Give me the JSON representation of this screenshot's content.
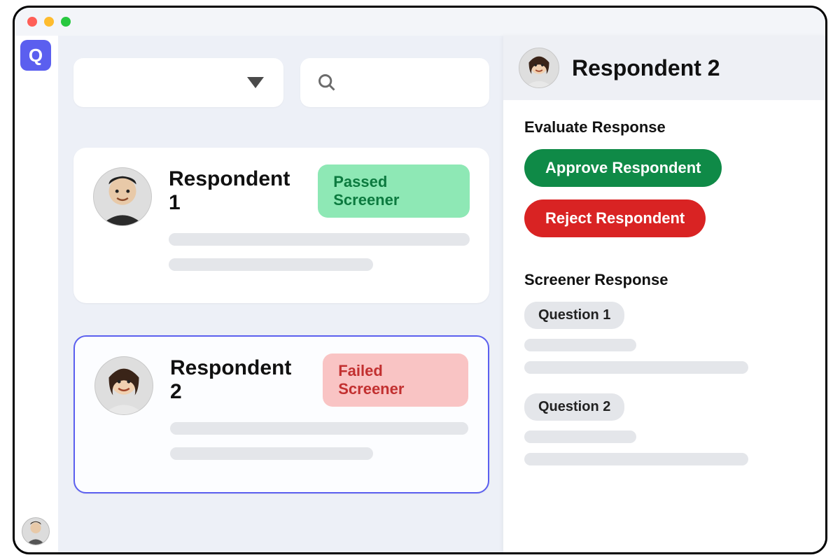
{
  "app": {
    "logo_letter": "Q"
  },
  "toolbar": {
    "dropdown_value": "",
    "search_value": ""
  },
  "list": {
    "items": [
      {
        "name": "Respondent 1",
        "status_label": "Passed Screener",
        "status": "pass"
      },
      {
        "name": "Respondent 2",
        "status_label": "Failed Screener",
        "status": "fail"
      }
    ],
    "selected_index": 1
  },
  "panel": {
    "title": "Respondent 2",
    "evaluate_heading": "Evaluate Response",
    "approve_label": "Approve Respondent",
    "reject_label": "Reject Respondent",
    "screener_heading": "Screener Response",
    "questions": [
      {
        "label": "Question 1"
      },
      {
        "label": "Question 2"
      }
    ]
  }
}
